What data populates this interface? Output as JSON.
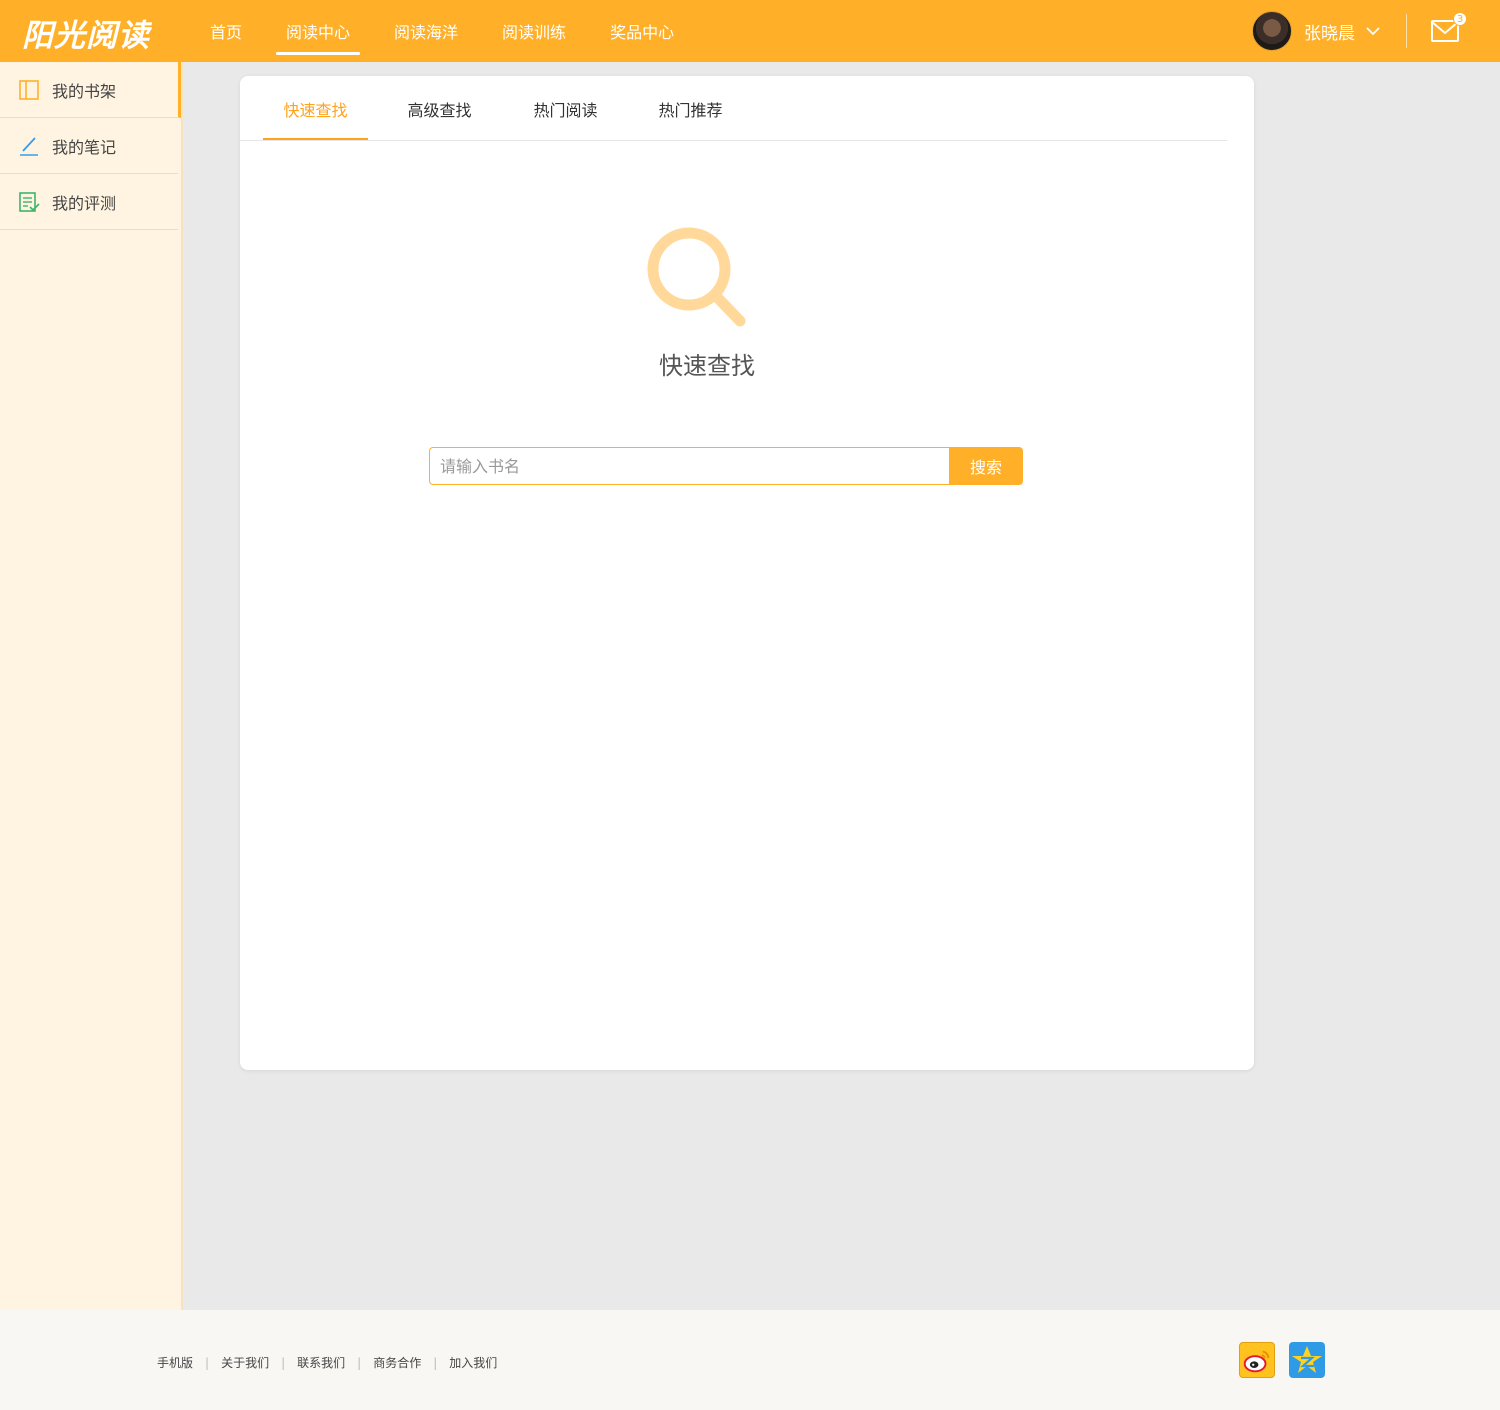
{
  "brand": {
    "logo": "阳光阅读",
    "accent": "#ffb028",
    "active_tab_color": "#ffa21d"
  },
  "nav": {
    "items": [
      {
        "label": "首页",
        "active": false
      },
      {
        "label": "阅读中心",
        "active": true
      },
      {
        "label": "阅读海洋",
        "active": false
      },
      {
        "label": "阅读训练",
        "active": false
      },
      {
        "label": "奖品中心",
        "active": false
      }
    ]
  },
  "user": {
    "name": "张晓晨",
    "avatar_icon": "user-avatar",
    "dropdown_icon": "chevron-down-icon"
  },
  "messages": {
    "icon": "mail-icon",
    "badge_count": "3"
  },
  "sidebar": {
    "items": [
      {
        "label": "我的书架",
        "icon": "bookshelf-icon",
        "active": true
      },
      {
        "label": "我的笔记",
        "icon": "pen-icon",
        "active": false
      },
      {
        "label": "我的评测",
        "icon": "checklist-icon",
        "active": false
      }
    ]
  },
  "tabs": {
    "items": [
      {
        "label": "快速查找",
        "active": true
      },
      {
        "label": "高级查找",
        "active": false
      },
      {
        "label": "热门阅读",
        "active": false
      },
      {
        "label": "热门推荐",
        "active": false
      }
    ]
  },
  "hero": {
    "icon": "search-icon",
    "title": "快速查找"
  },
  "search": {
    "value": "",
    "placeholder": "请输入书名",
    "button_label": "搜索"
  },
  "footer": {
    "links": [
      {
        "label": "手机版"
      },
      {
        "label": "关于我们"
      },
      {
        "label": "联系我们"
      },
      {
        "label": "商务合作"
      },
      {
        "label": "加入我们"
      }
    ],
    "social": [
      {
        "icon": "weibo-icon"
      },
      {
        "icon": "qzone-icon"
      }
    ]
  }
}
